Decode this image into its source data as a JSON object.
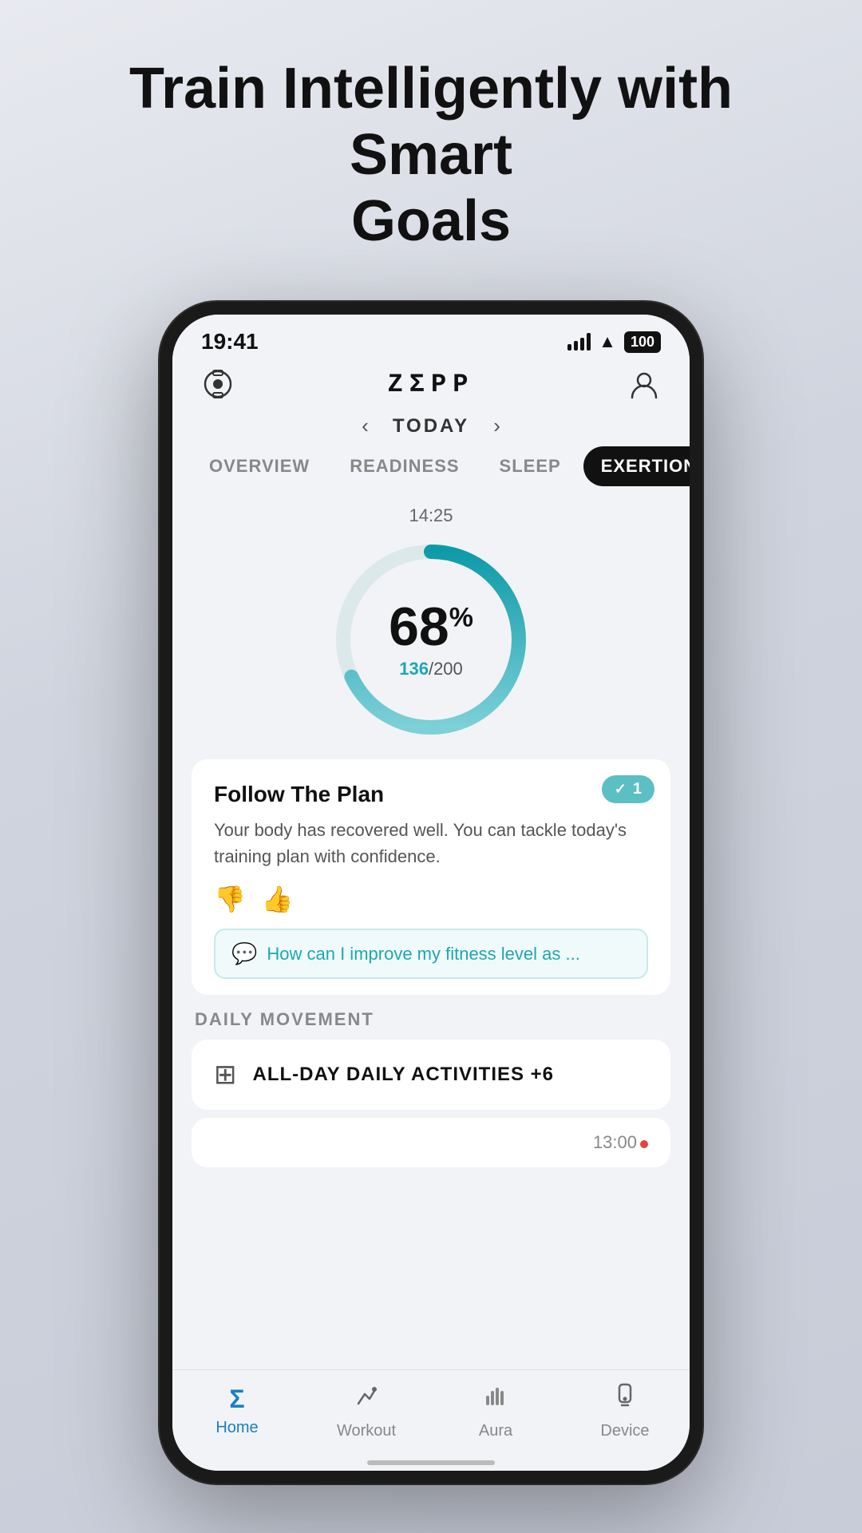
{
  "page": {
    "title_line1": "Train Intelligently with Smart",
    "title_line2": "Goals"
  },
  "status_bar": {
    "time": "19:41",
    "battery": "100"
  },
  "app": {
    "logo": "ZEPP"
  },
  "date_nav": {
    "label": "TODAY",
    "prev_arrow": "‹",
    "next_arrow": "›"
  },
  "tabs": [
    {
      "id": "overview",
      "label": "OVERVIEW",
      "active": false
    },
    {
      "id": "readiness",
      "label": "READINESS",
      "active": false
    },
    {
      "id": "sleep",
      "label": "SLEEP",
      "active": false
    },
    {
      "id": "exertion",
      "label": "EXERTION",
      "active": true
    }
  ],
  "gauge": {
    "time": "14:25",
    "percent": "68",
    "current": "136",
    "total": "200",
    "progress": 0.68
  },
  "plan_card": {
    "badge_count": "1",
    "title": "Follow The Plan",
    "description": "Your body has recovered well. You can tackle today's training plan with confidence.",
    "ask_text": "How can I improve my fitness level as ..."
  },
  "daily_movement": {
    "section_label": "DAILY MOVEMENT",
    "activity_label": "ALL-DAY DAILY ACTIVITIES +6",
    "time_partial": "13:00"
  },
  "bottom_nav": [
    {
      "id": "home",
      "label": "Home",
      "icon": "Σ",
      "active": true
    },
    {
      "id": "workout",
      "label": "Workout",
      "icon": "🏃",
      "active": false
    },
    {
      "id": "aura",
      "label": "Aura",
      "icon": "📊",
      "active": false
    },
    {
      "id": "device",
      "label": "Device",
      "icon": "⌚",
      "active": false
    }
  ]
}
